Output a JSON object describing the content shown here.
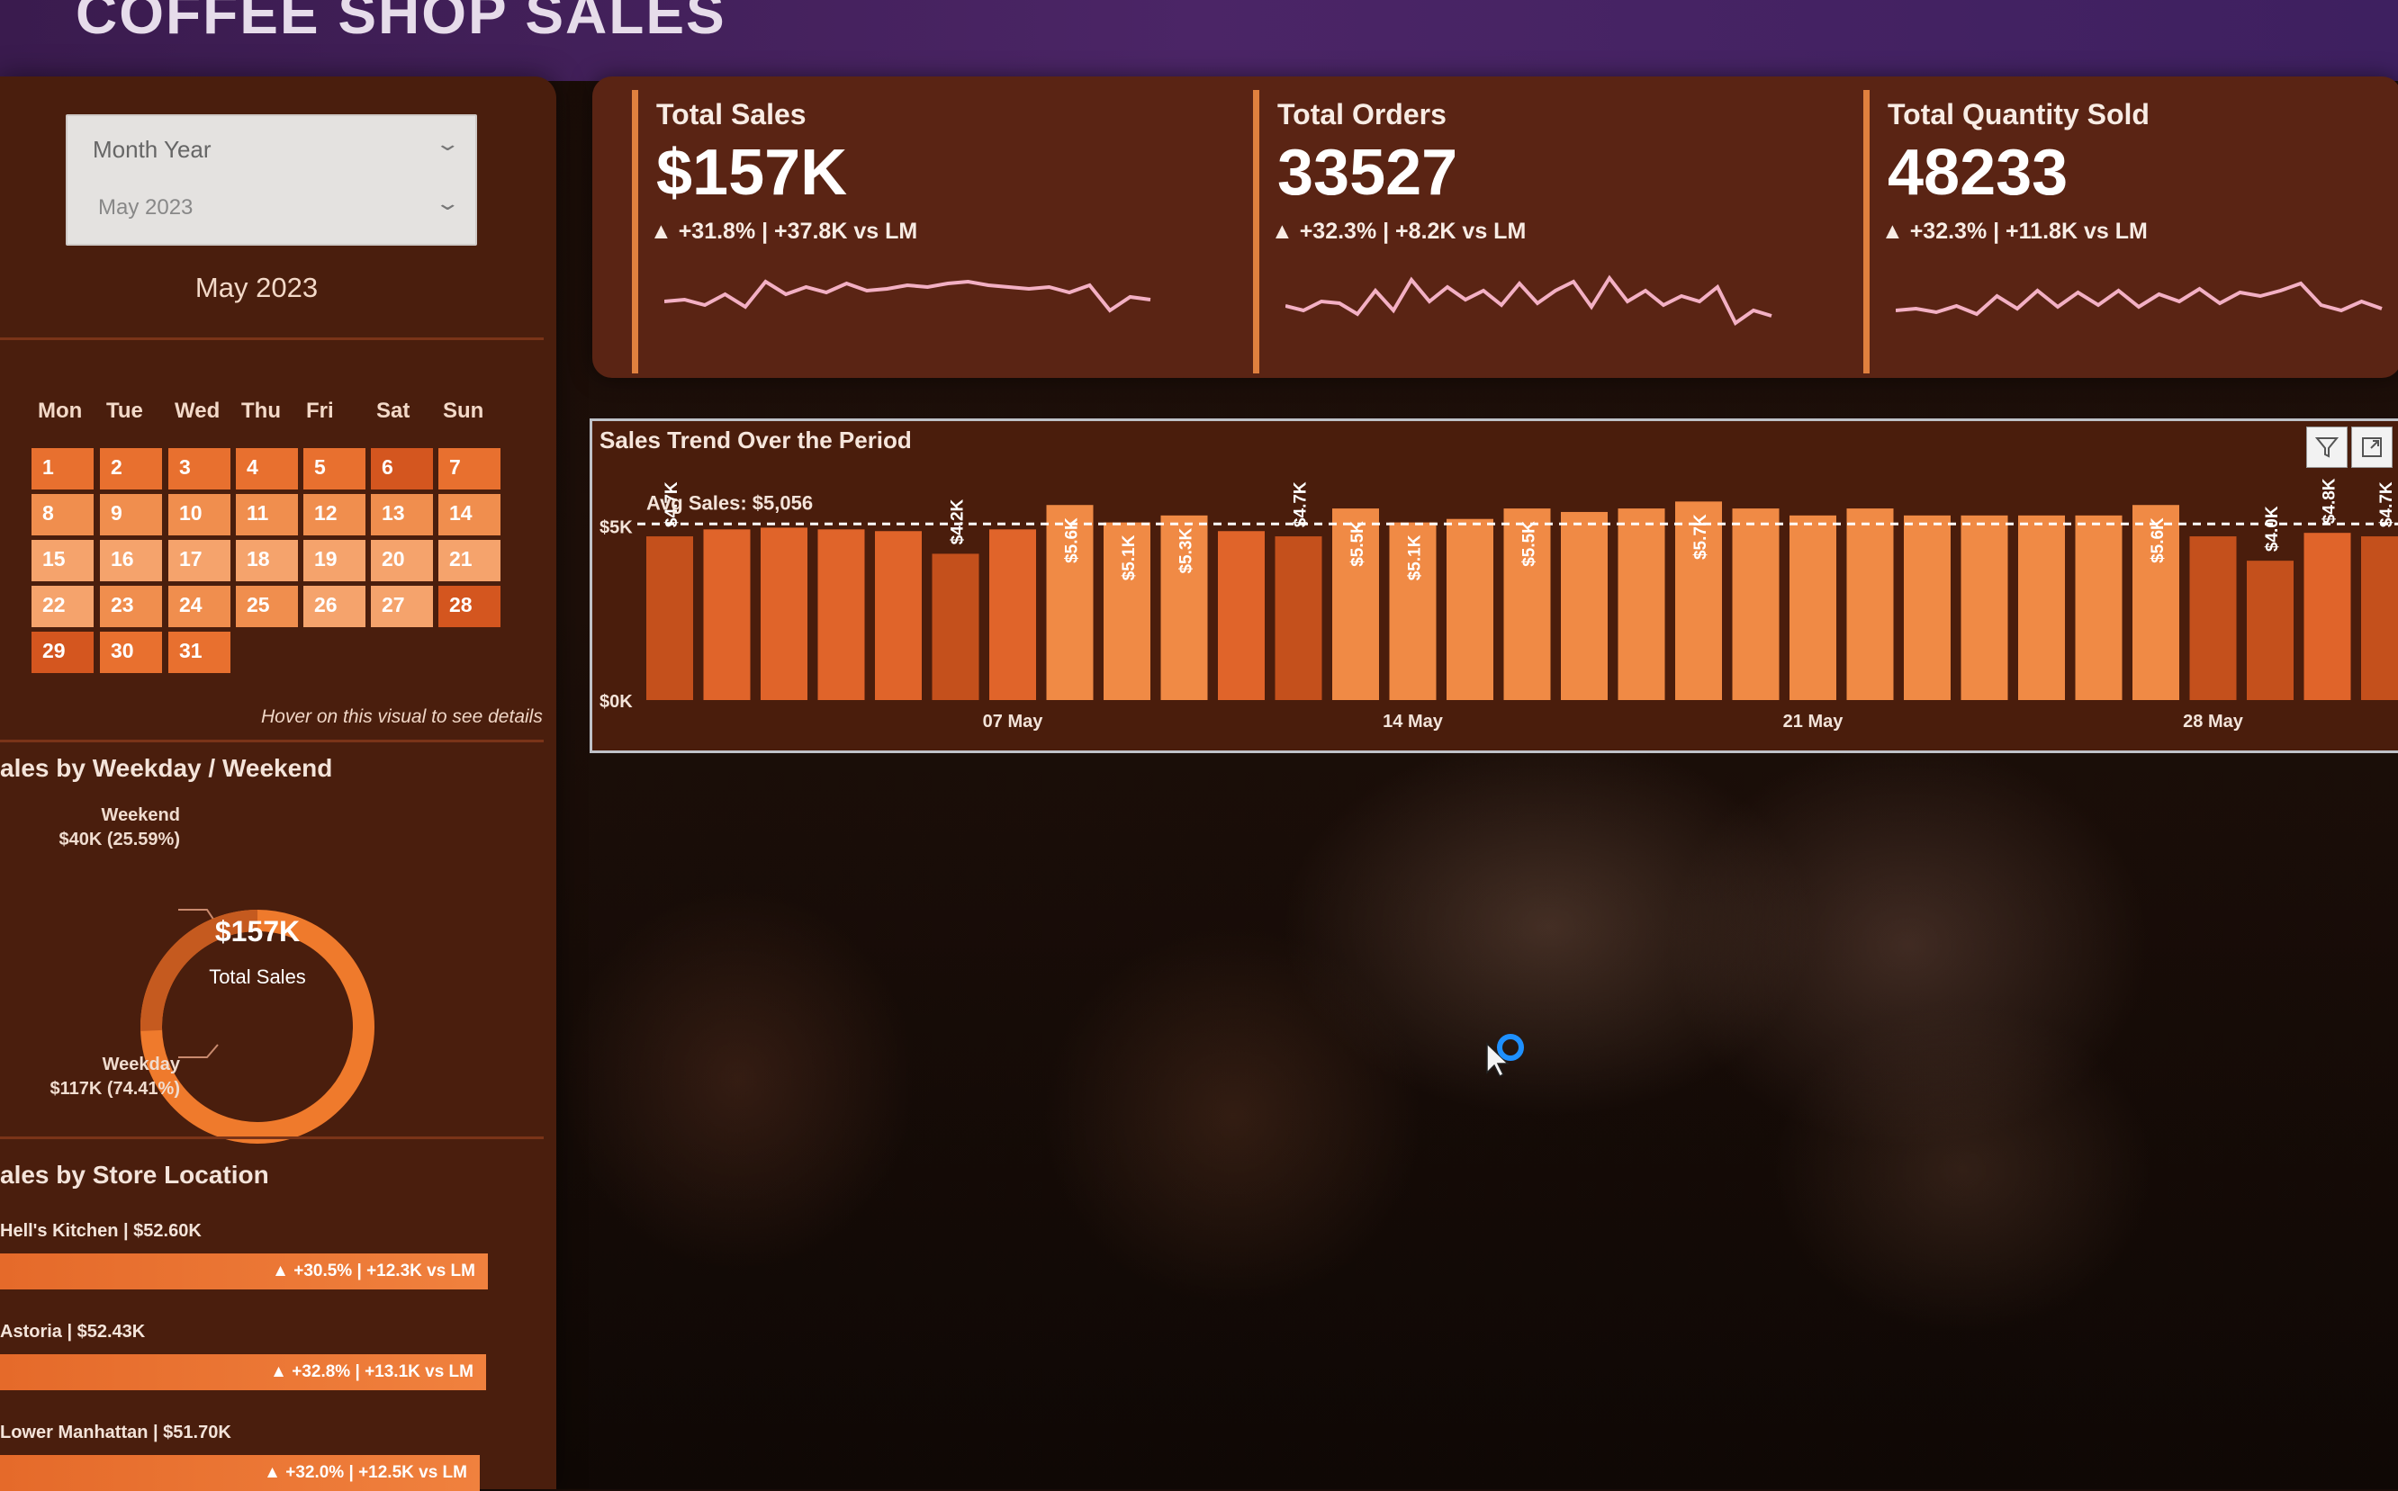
{
  "app": {
    "title": "COFFEE SHOP SALES"
  },
  "slicer": {
    "title": "Month Year",
    "value": "May 2023"
  },
  "calendar": {
    "title": "May 2023",
    "weekdays": [
      "Mon",
      "Tue",
      "Wed",
      "Thu",
      "Fri",
      "Sat",
      "Sun"
    ],
    "days": [
      {
        "d": "1",
        "shade": "mid"
      },
      {
        "d": "2",
        "shade": "mid"
      },
      {
        "d": "3",
        "shade": "mid"
      },
      {
        "d": "4",
        "shade": "mid"
      },
      {
        "d": "5",
        "shade": "mid"
      },
      {
        "d": "6",
        "shade": "dark"
      },
      {
        "d": "7",
        "shade": "mid"
      },
      {
        "d": "8",
        "shade": "light"
      },
      {
        "d": "9",
        "shade": "light"
      },
      {
        "d": "10",
        "shade": "light"
      },
      {
        "d": "11",
        "shade": "light"
      },
      {
        "d": "12",
        "shade": "light"
      },
      {
        "d": "13",
        "shade": "light"
      },
      {
        "d": "14",
        "shade": "light"
      },
      {
        "d": "15",
        "shade": "pale"
      },
      {
        "d": "16",
        "shade": "pale"
      },
      {
        "d": "17",
        "shade": "pale"
      },
      {
        "d": "18",
        "shade": "pale"
      },
      {
        "d": "19",
        "shade": "pale"
      },
      {
        "d": "20",
        "shade": "pale"
      },
      {
        "d": "21",
        "shade": "pale"
      },
      {
        "d": "22",
        "shade": "pale"
      },
      {
        "d": "23",
        "shade": "light"
      },
      {
        "d": "24",
        "shade": "light"
      },
      {
        "d": "25",
        "shade": "light"
      },
      {
        "d": "26",
        "shade": "pale"
      },
      {
        "d": "27",
        "shade": "pale"
      },
      {
        "d": "28",
        "shade": "dark"
      },
      {
        "d": "29",
        "shade": "dark"
      },
      {
        "d": "30",
        "shade": "mid"
      },
      {
        "d": "31",
        "shade": "mid"
      }
    ],
    "hint": "Hover on this visual to see details"
  },
  "weekday_weekend": {
    "title": "ales by Weekday / Weekend",
    "weekend_label": "Weekend",
    "weekend_value": "$40K (25.59%)",
    "weekday_label": "Weekday",
    "weekday_value": "$117K (74.41%)",
    "center_value": "$157K",
    "center_label": "Total Sales",
    "weekend_share": 0.2559
  },
  "store_location": {
    "title": "ales by Store Location",
    "stores": [
      {
        "name": "Hell's Kitchen | $52.60K",
        "delta": "▲ +30.5% | +12.3K vs LM",
        "value": 52.6
      },
      {
        "name": "Astoria | $52.43K",
        "delta": "▲ +32.8% | +13.1K vs LM",
        "value": 52.43
      },
      {
        "name": "Lower Manhattan | $51.70K",
        "delta": "▲ +32.0% | +12.5K vs LM",
        "value": 51.7
      }
    ]
  },
  "kpis": [
    {
      "title": "Total Sales",
      "value": "$157K",
      "delta": "▲ +31.8% | +37.8K vs LM",
      "spark": [
        0.5,
        0.52,
        0.46,
        0.58,
        0.44,
        0.72,
        0.58,
        0.66,
        0.6,
        0.7,
        0.62,
        0.64,
        0.68,
        0.66,
        0.7,
        0.72,
        0.68,
        0.66,
        0.64,
        0.66,
        0.6,
        0.68,
        0.4,
        0.55,
        0.52
      ]
    },
    {
      "title": "Total Orders",
      "value": "33527",
      "delta": "▲ +32.3% | +8.2K vs LM",
      "spark": [
        0.45,
        0.4,
        0.5,
        0.48,
        0.36,
        0.62,
        0.4,
        0.74,
        0.5,
        0.66,
        0.52,
        0.62,
        0.46,
        0.7,
        0.48,
        0.62,
        0.72,
        0.44,
        0.76,
        0.5,
        0.62,
        0.46,
        0.56,
        0.5,
        0.66,
        0.26,
        0.4,
        0.34
      ]
    },
    {
      "title": "Total Quantity Sold",
      "value": "48233",
      "delta": "▲ +32.3% | +11.8K vs LM",
      "spark": [
        0.4,
        0.42,
        0.38,
        0.45,
        0.36,
        0.56,
        0.42,
        0.62,
        0.44,
        0.6,
        0.46,
        0.62,
        0.44,
        0.58,
        0.5,
        0.64,
        0.48,
        0.6,
        0.56,
        0.62,
        0.7,
        0.46,
        0.4,
        0.5,
        0.42
      ]
    }
  ],
  "chart_data": {
    "type": "bar",
    "title": "Sales Trend Over the Period",
    "avg_label": "Avg Sales: $5,056",
    "average": 5056,
    "y_tick_labels": [
      "$5K",
      "$0K"
    ],
    "y_ticks": [
      5000,
      0
    ],
    "ylim": [
      0,
      6200
    ],
    "x_tick_labels": [
      "07 May",
      "14 May",
      "21 May",
      "28 May"
    ],
    "x_tick_days": [
      7,
      14,
      21,
      28
    ],
    "days": [
      1,
      2,
      3,
      4,
      5,
      6,
      7,
      8,
      9,
      10,
      11,
      12,
      13,
      14,
      15,
      16,
      17,
      18,
      19,
      20,
      21,
      22,
      23,
      24,
      25,
      26,
      27,
      28,
      29,
      30,
      31
    ],
    "values": [
      4700,
      4900,
      4950,
      4900,
      4850,
      4200,
      4900,
      5600,
      5100,
      5300,
      4850,
      4700,
      5500,
      5100,
      5200,
      5500,
      5400,
      5500,
      5700,
      5500,
      5300,
      5500,
      5300,
      5300,
      5300,
      5300,
      5600,
      4700,
      4000,
      4800,
      4700
    ],
    "bar_labels": [
      "$4.7K",
      "",
      "",
      "",
      "",
      "$4.2K",
      "",
      "$5.6K",
      "$5.1K",
      "$5.3K",
      "",
      "$4.7K",
      "$5.5K",
      "$5.1K",
      "",
      "$5.5K",
      "",
      "",
      "$5.7K",
      "",
      "",
      "",
      "",
      "",
      "",
      "",
      "$5.6K",
      "",
      "$4.0K",
      "$4.8K",
      "$4.7K"
    ],
    "grid": false,
    "legend": "none"
  }
}
